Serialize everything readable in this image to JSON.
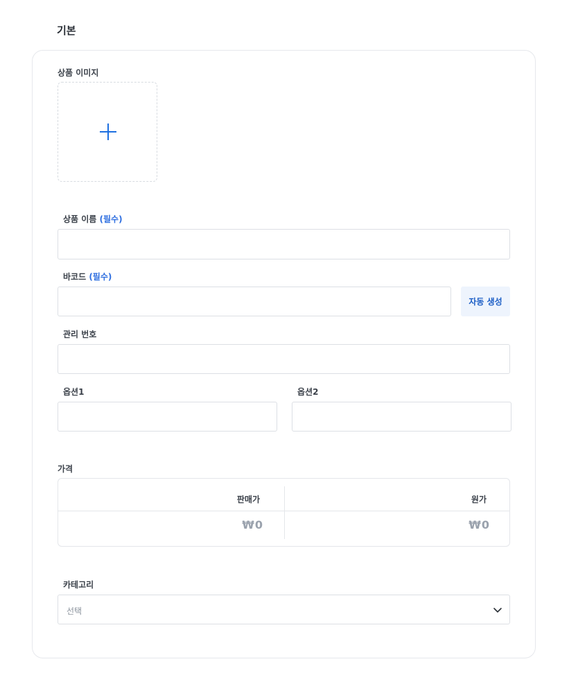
{
  "section": {
    "title": "기본"
  },
  "image": {
    "label": "상품 이미지"
  },
  "product_name": {
    "label": "상품 이름",
    "required": "(필수)",
    "value": ""
  },
  "barcode": {
    "label": "바코드",
    "required": "(필수)",
    "value": "",
    "auto_button": "자동 생성"
  },
  "manage_no": {
    "label": "관리 번호",
    "value": ""
  },
  "option1": {
    "label": "옵션1",
    "value": ""
  },
  "option2": {
    "label": "옵션2",
    "value": ""
  },
  "price": {
    "label": "가격",
    "sale_header": "판매가",
    "cost_header": "원가",
    "sale_value": "₩0",
    "cost_value": "₩0"
  },
  "category": {
    "label": "카테고리",
    "placeholder": "선택"
  },
  "colors": {
    "accent": "#2f6fe0",
    "button_bg": "#eef4fd",
    "border": "#dcdfe4"
  }
}
